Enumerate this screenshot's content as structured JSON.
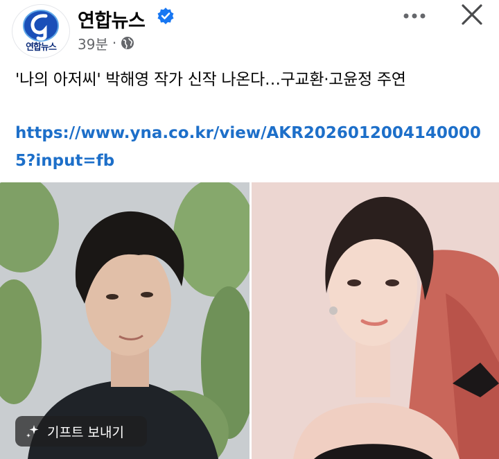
{
  "page": {
    "name": "연합뉴스",
    "logo_text": "연합뉴스",
    "time": "39분",
    "separator": "·",
    "audience_icon": "globe-icon",
    "verified_icon": "verified-badge-icon"
  },
  "header_actions": {
    "more_icon": "more-horizontal-icon",
    "close_icon": "close-icon"
  },
  "post": {
    "text": "'나의 아저씨' 박해영 작가 신작 나온다…구교환·고윤정 주연",
    "link": "https://www.yna.co.kr/view/AKR20260120041400005?input=fb"
  },
  "gift_button": {
    "label": "기프트 보내기",
    "icon": "gift-sparkle-icon"
  },
  "colors": {
    "link": "#1d6fc9",
    "verified": "#1877f2",
    "meta_text": "#65676b",
    "logo_blue": "#1a4fb8"
  }
}
